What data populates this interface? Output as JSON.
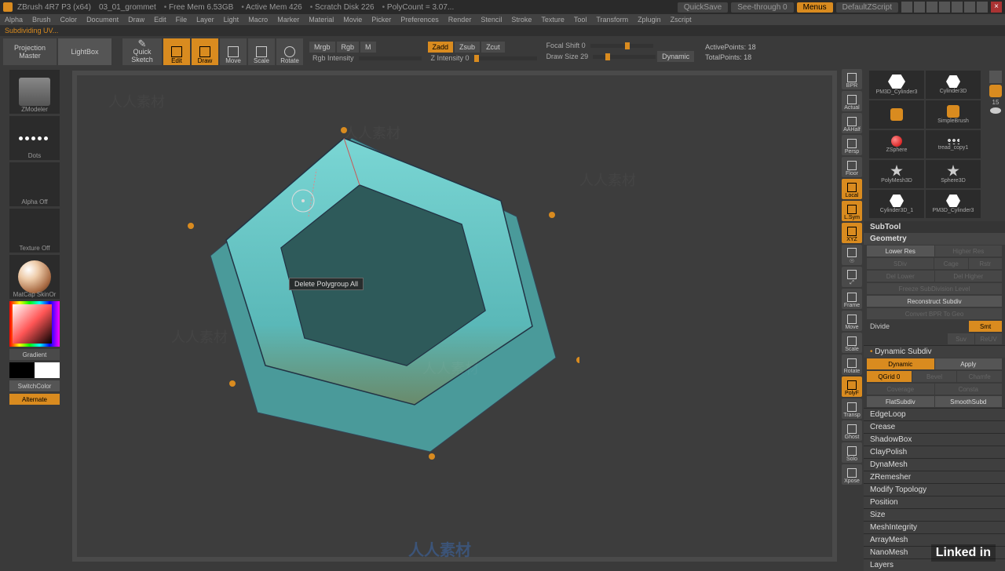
{
  "titlebar": {
    "app": "ZBrush 4R7 P3 (x64)",
    "doc": "03_01_grommet",
    "freemem": "Free Mem 6.53GB",
    "activemem": "Active Mem 426",
    "scratch": "Scratch Disk 226",
    "polycount": "PolyCount = 3.07...",
    "quicksave": "QuickSave",
    "seethrough": "See-through  0",
    "menus": "Menus",
    "defaultzscript": "DefaultZScript"
  },
  "menubar": [
    "Alpha",
    "Brush",
    "Color",
    "Document",
    "Draw",
    "Edit",
    "File",
    "Layer",
    "Light",
    "Macro",
    "Marker",
    "Material",
    "Movie",
    "Picker",
    "Preferences",
    "Render",
    "Stencil",
    "Stroke",
    "Texture",
    "Tool",
    "Transform",
    "Zplugin",
    "Zscript"
  ],
  "status": "Subdividing UV...",
  "toolbar": {
    "projection": "Projection\nMaster",
    "lightbox": "LightBox",
    "quicksketch": "Quick\nSketch",
    "edit": "Edit",
    "draw": "Draw",
    "move": "Move",
    "scale": "Scale",
    "rotate": "Rotate",
    "mrgb": "Mrgb",
    "rgb": "Rgb",
    "m": "M",
    "rgb_intensity": "Rgb Intensity",
    "zadd": "Zadd",
    "zsub": "Zsub",
    "zcut": "Zcut",
    "z_intensity": "Z Intensity 0",
    "focal": "Focal Shift 0",
    "drawsize": "Draw Size 29",
    "dynamic": "Dynamic",
    "active": "ActivePoints: 18",
    "total": "TotalPoints: 18"
  },
  "left": {
    "zmodeler": "ZModeler",
    "dots": "Dots",
    "alpha": "Alpha Off",
    "texture": "Texture Off",
    "matcap": "MatCap SkinOr",
    "gradient": "Gradient",
    "switch": "SwitchColor",
    "alternate": "Alternate"
  },
  "tooltip": "Delete Polygroup All",
  "mid": [
    "BPR",
    "Actual",
    "AAHalf",
    "Persp",
    "Floor",
    "Local",
    "L.Sym",
    "XYZ",
    "☉",
    "⤢",
    "Frame",
    "Move",
    "Scale",
    "Rotate",
    "PolyF",
    "Transp",
    "Ghost",
    "Solo",
    "Xpose"
  ],
  "mid_on": {
    "Local": true,
    "L.Sym": true,
    "XYZ": true,
    "PolyF": true
  },
  "tools": {
    "items": [
      {
        "label": "PM3D_Cylinder3",
        "shape": "hex"
      },
      {
        "label": "Cylinder3D",
        "shape": "hex2"
      },
      {
        "label": "",
        "shape": "s"
      },
      {
        "label": "SimpleBrush",
        "shape": "s"
      },
      {
        "label": "ZSphere",
        "shape": "ball"
      },
      {
        "label": "tread_copy1",
        "shape": "dots"
      },
      {
        "label": "PolyMesh3D",
        "shape": "star"
      },
      {
        "label": "Sphere3D",
        "shape": "star"
      },
      {
        "label": "Cylinder3D_1",
        "shape": "hex2"
      },
      {
        "label": "PM3D_Cylinder3",
        "shape": "hex2"
      }
    ],
    "fifteen": "15"
  },
  "panel": {
    "subtool": "SubTool",
    "geometry": "Geometry",
    "rows1": [
      [
        "Lower Res",
        "Higher Res"
      ],
      [
        "SDiv",
        "Cage",
        "Rstr"
      ],
      [
        "Del Lower",
        "Del Higher"
      ],
      [
        "Freeze SubDivision Level"
      ],
      [
        "Reconstruct Subdiv"
      ],
      [
        "Convert BPR To Geo"
      ]
    ],
    "divide": "Divide",
    "divide_r": [
      "Smt",
      "Suv",
      "ReUV"
    ],
    "dyn": "Dynamic Subdiv",
    "dyn_row": [
      "Dynamic",
      "Apply"
    ],
    "qgrid": "QGrid 0",
    "qgrid_r": [
      "Bevel",
      "Chamfe"
    ],
    "cov": [
      "Coverage",
      "Consta"
    ],
    "flat": [
      "FlatSubdiv",
      "SmoothSubd"
    ],
    "subs": [
      "EdgeLoop",
      "Crease",
      "ShadowBox",
      "ClayPolish",
      "DynaMesh",
      "ZRemesher",
      "Modify Topology",
      "Position",
      "Size",
      "MeshIntegrity",
      "ArrayMesh",
      "NanoMesh",
      "Layers"
    ]
  },
  "brand_footer": "Linked in",
  "center_footer": "人人素材"
}
